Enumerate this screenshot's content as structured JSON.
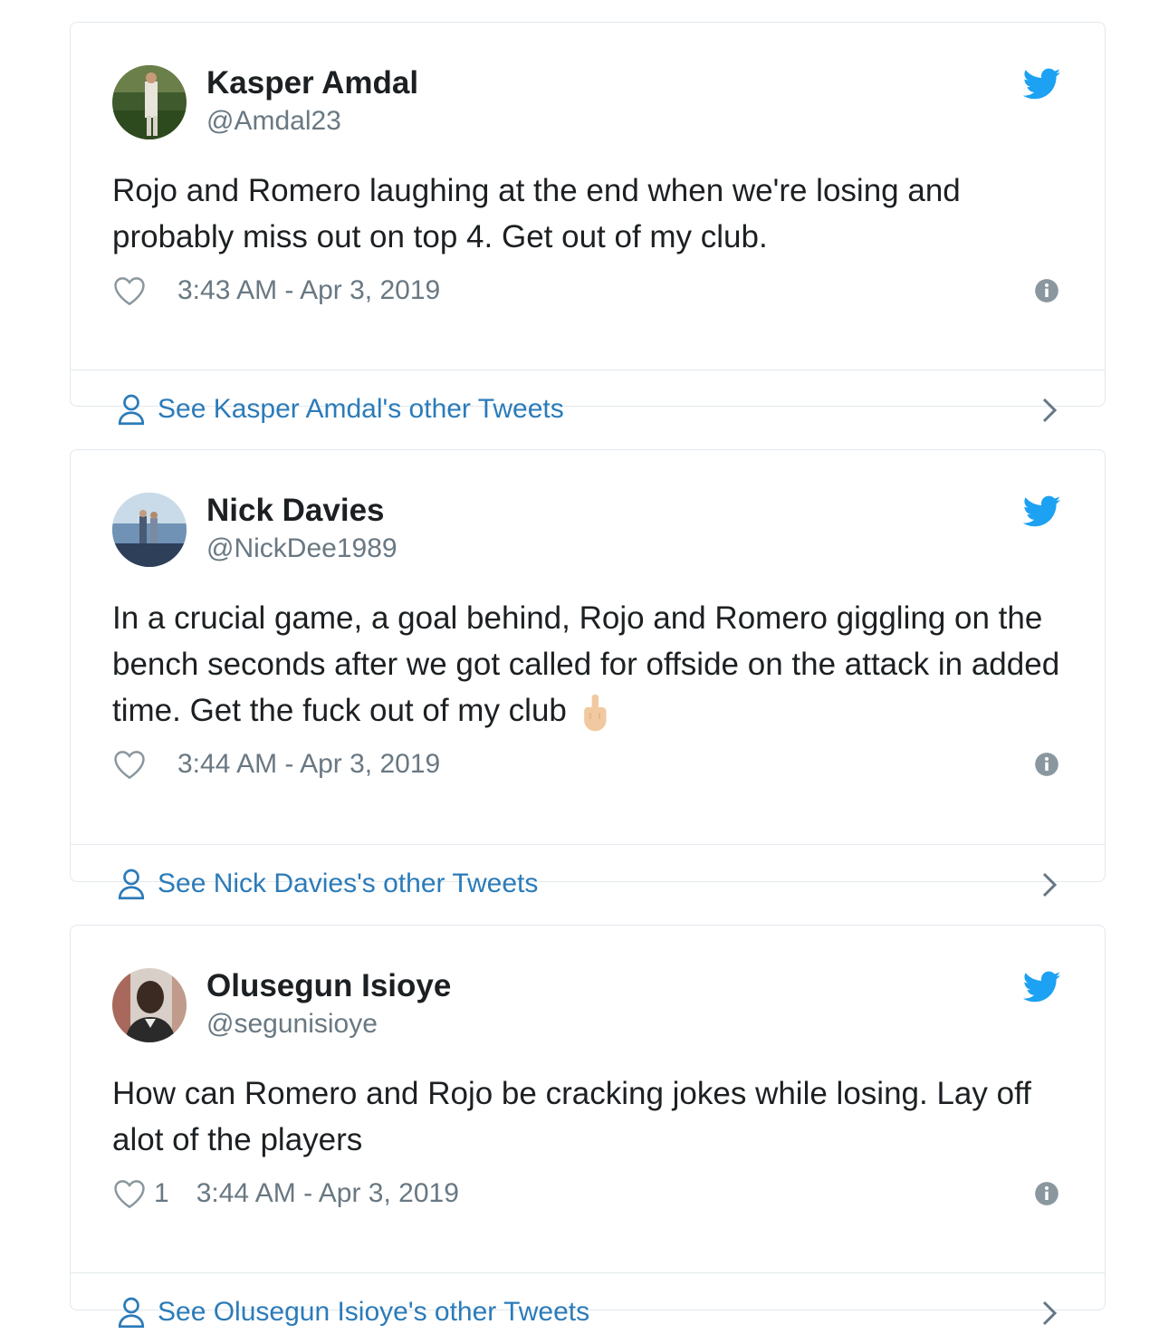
{
  "colors": {
    "twitter_blue": "#1da1f2",
    "link_blue": "#2b7bb9",
    "secondary_text": "#697882",
    "border": "#e1e8ed"
  },
  "tweets": [
    {
      "display_name": "Kasper Amdal",
      "handle": "@Amdal23",
      "text": "Rojo and Romero laughing at the end when we're losing and probably miss out on top 4. Get out of my club.",
      "emoji": "",
      "likes": "",
      "timestamp": "3:43 AM - Apr 3, 2019",
      "other_tweets_label": "See Kasper Amdal's other Tweets"
    },
    {
      "display_name": "Nick Davies",
      "handle": "@NickDee1989",
      "text": "In a crucial game, a goal behind, Rojo and Romero giggling on the bench seconds after we got called for offside on the attack in added time. Get the fuck out of my club",
      "emoji": "middle-finger-emoji",
      "likes": "",
      "timestamp": "3:44 AM - Apr 3, 2019",
      "other_tweets_label": "See Nick Davies's other Tweets"
    },
    {
      "display_name": "Olusegun Isioye",
      "handle": "@segunisioye",
      "text": "How can Romero and Rojo be cracking jokes while losing. Lay off alot of the players",
      "emoji": "",
      "likes": "1",
      "timestamp": "3:44 AM - Apr 3, 2019",
      "other_tweets_label": "See Olusegun Isioye's other Tweets"
    }
  ],
  "icons": {
    "brand": "twitter-bird-icon",
    "like": "heart-icon",
    "info": "info-icon",
    "profile": "person-icon",
    "navigate": "chevron-right-icon"
  }
}
